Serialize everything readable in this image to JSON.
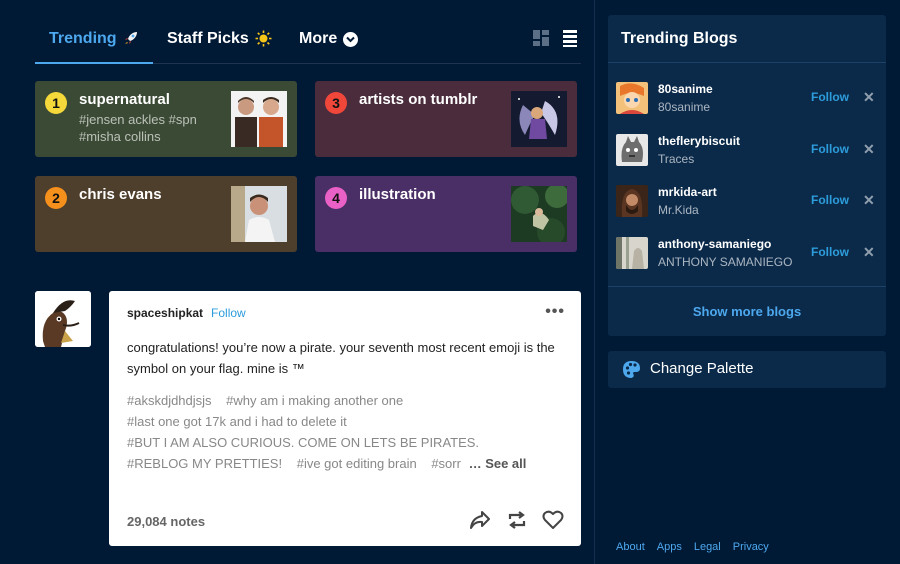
{
  "tabs": [
    {
      "label": "Trending",
      "active": true,
      "icon": "rocket-icon"
    },
    {
      "label": "Staff Picks",
      "active": false,
      "icon": "sun-icon"
    },
    {
      "label": "More",
      "active": false,
      "icon": "chevron-down-circle-icon"
    }
  ],
  "view_toggles": [
    "grid-view-icon",
    "list-view-icon"
  ],
  "trending": [
    {
      "rank": "1",
      "title": "supernatural",
      "tags": "#jensen ackles #spn #misha collins",
      "num_color": "#f5d93a"
    },
    {
      "rank": "2",
      "title": "chris evans",
      "tags": "",
      "num_color": "#f5901c"
    },
    {
      "rank": "3",
      "title": "artists on tumblr",
      "tags": "",
      "num_color": "#f0473a"
    },
    {
      "rank": "4",
      "title": "illustration",
      "tags": "",
      "num_color": "#e960c6"
    }
  ],
  "post": {
    "author": "spaceshipkat",
    "follow": "Follow",
    "menu": "•••",
    "body": "congratulations! you’re now a pirate. your seventh most recent emoji is the symbol on your flag. mine is ™",
    "tags": [
      "#akskdjdhdjsjs",
      "#why am i making another one",
      "#last one got 17k and i had to delete it",
      "#BUT I AM ALSO CURIOUS. COME ON LETS BE PIRATES.",
      "#REBLOG MY PRETTIES!",
      "#ive got editing brain",
      "#sorr"
    ],
    "see_all": "… See all",
    "notes": "29,084 notes"
  },
  "sidebar": {
    "title": "Trending Blogs",
    "blogs": [
      {
        "name": "80sanime",
        "subtitle": "80sanime",
        "follow": "Follow"
      },
      {
        "name": "theflerybiscuit",
        "subtitle": "Traces",
        "follow": "Follow"
      },
      {
        "name": "mrkida-art",
        "subtitle": "Mr.Kida",
        "follow": "Follow"
      },
      {
        "name": "anthony-samaniego",
        "subtitle": "ANTHONY SAMANIEGO",
        "follow": "Follow"
      }
    ],
    "show_more": "Show more blogs",
    "palette": "Change Palette",
    "footer": [
      "About",
      "Apps",
      "Legal",
      "Privacy"
    ]
  },
  "colors": {
    "background": "#001935",
    "accent": "#4da8ee",
    "panel": "#0b2a4a"
  }
}
